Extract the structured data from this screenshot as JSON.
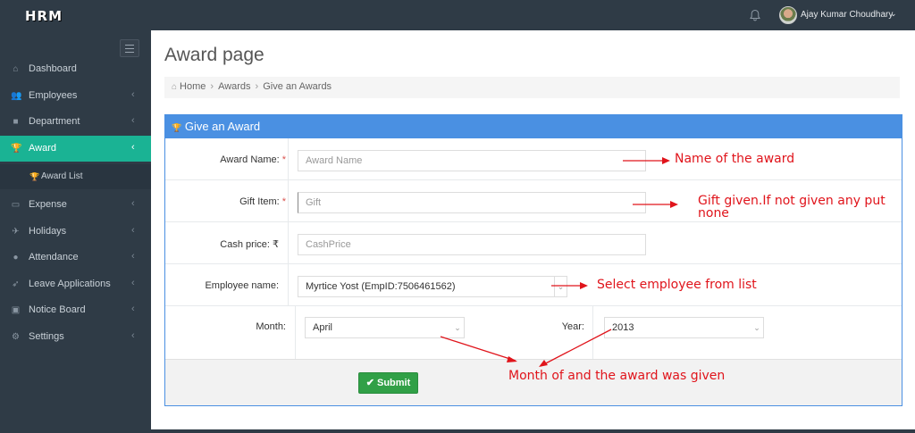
{
  "app": {
    "logo": "HRM"
  },
  "user": {
    "name": "Ajay Kumar Choudhary"
  },
  "sidebar": {
    "items": [
      {
        "label": "Dashboard",
        "icon": "home-icon",
        "glyph": "⌂"
      },
      {
        "label": "Employees",
        "icon": "users-icon",
        "glyph": "👥",
        "caret": "‹"
      },
      {
        "label": "Department",
        "icon": "briefcase-icon",
        "glyph": "■",
        "caret": "‹"
      },
      {
        "label": "Award",
        "icon": "trophy-icon",
        "glyph": "🏆",
        "caret": "‹",
        "active": true
      },
      {
        "label": "Expense",
        "icon": "money-icon",
        "glyph": "▭",
        "caret": "‹"
      },
      {
        "label": "Holidays",
        "icon": "plane-icon",
        "glyph": "✈",
        "caret": "‹"
      },
      {
        "label": "Attendance",
        "icon": "user-icon",
        "glyph": "●",
        "caret": "‹"
      },
      {
        "label": "Leave Applications",
        "icon": "rocket-icon",
        "glyph": "➶",
        "caret": "‹"
      },
      {
        "label": "Notice Board",
        "icon": "clipboard-icon",
        "glyph": "▣",
        "caret": "‹"
      },
      {
        "label": "Settings",
        "icon": "cogs-icon",
        "glyph": "⚙",
        "caret": "‹"
      }
    ],
    "sub_items": [
      {
        "label": "Award List",
        "icon": "trophy-small-icon",
        "glyph": "🏆"
      }
    ]
  },
  "page": {
    "title": "Award page",
    "breadcrumb": [
      "Home",
      "Awards",
      "Give an Awards"
    ]
  },
  "form": {
    "heading": "Give an Award",
    "award_name": {
      "label": "Award Name:",
      "placeholder": "Award Name"
    },
    "gift_item": {
      "label": "Gift Item:",
      "placeholder": "Gift"
    },
    "cash_price": {
      "label": "Cash price: ₹",
      "placeholder": "CashPrice"
    },
    "employee": {
      "label": "Employee name:",
      "value": "Myrtice Yost (EmpID:7506461562)"
    },
    "month": {
      "label": "Month:",
      "value": "April"
    },
    "year": {
      "label": "Year:",
      "value": "2013"
    },
    "required_mark": "*",
    "submit_label": "Submit"
  },
  "annotations": {
    "award_name": "Name of the award",
    "gift_line1": "Gift given.If not given any put",
    "gift_line2": "none",
    "employee": "Select employee from list",
    "month_year": "Month of and the award was given"
  },
  "colors": {
    "accent": "#1ab394",
    "panel": "#4a90e2",
    "submit": "#31a047",
    "annotation": "#e0141b",
    "sidebar": "#2f3b46"
  }
}
